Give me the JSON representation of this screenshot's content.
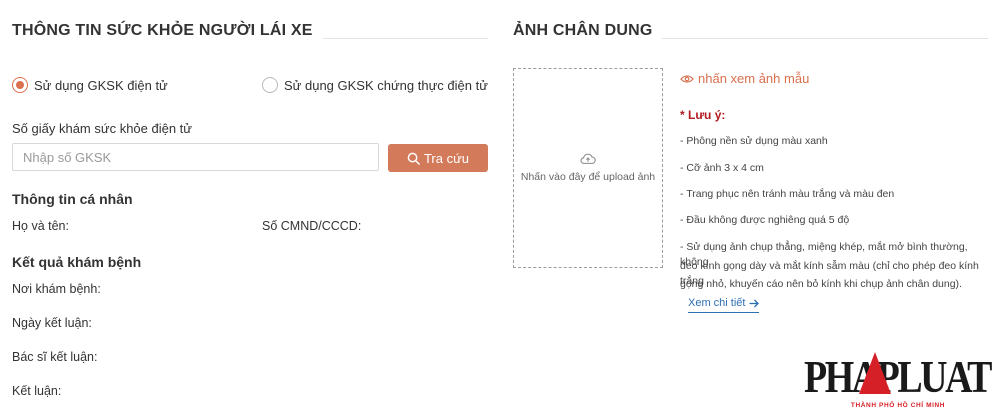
{
  "left": {
    "title": "THÔNG TIN SỨC KHỎE NGƯỜI LÁI XE",
    "radio_options": [
      {
        "label": "Sử dụng GKSK điện tử",
        "checked": true
      },
      {
        "label": "Sử dụng GKSK chứng thực điện tử",
        "checked": false
      }
    ],
    "gksk_label": "Số giấy khám sức khỏe điện tử",
    "gksk_placeholder": "Nhập số GKSK",
    "search_button": "Tra cứu",
    "personal_heading": "Thông tin cá nhân",
    "name_label": "Họ và tên:",
    "id_label": "Số CMND/CCCD:",
    "result_heading": "Kết quả khám bệnh",
    "place_label": "Nơi khám bệnh:",
    "date_label": "Ngày kết luận:",
    "doctor_label": "Bác sĩ kết luận:",
    "conclusion_label": "Kết luận:"
  },
  "right": {
    "title": "ẢNH CHÂN DUNG",
    "upload_text": "Nhấn vào đây để upload ảnh",
    "sample_link": "nhấn xem ảnh mẫu",
    "note_title": "* Lưu ý:",
    "notes": [
      "- Phông nền sử dụng màu xanh",
      "- Cỡ ảnh 3 x 4 cm",
      "- Trang phục nên tránh màu trắng và màu đen",
      "- Đầu không được nghiêng quá 5 độ"
    ],
    "note_long": [
      "- Sử dụng ảnh chụp thẳng, miệng khép, mắt mở bình thường, không",
      "đeo kính gọng dày và mắt kính sẫm màu (chỉ cho phép đeo kính trắng",
      "gọng nhỏ, khuyến cáo nên bỏ kính khi chụp ảnh chân dung)."
    ],
    "more_link": "Xem chi tiết"
  },
  "watermark": {
    "brand": "PHAPLUAT",
    "subtitle": "THÀNH PHỐ HỒ CHÍ MINH"
  },
  "colors": {
    "accent": "#d37a5a",
    "note_red": "#b3181f",
    "link_blue": "#2d6fb3"
  },
  "icons": [
    "search-icon",
    "eye-icon",
    "upload-cloud-icon",
    "arrow-right-icon"
  ]
}
